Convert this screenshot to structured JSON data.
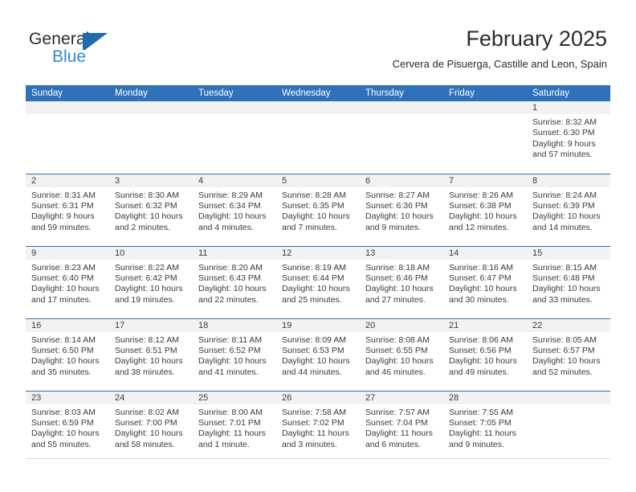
{
  "brand": {
    "name_part1": "General",
    "name_part2": "Blue",
    "flag_icon": "flag-triangle-icon"
  },
  "header": {
    "title": "February 2025",
    "subtitle": "Cervera de Pisuerga, Castille and Leon, Spain"
  },
  "theme": {
    "header_blue": "#3071b9",
    "daynum_band": "#f2f2f2",
    "brand_blue": "#2e8bd8",
    "text": "#3a3a3a"
  },
  "calendar": {
    "weekday_headers": [
      "Sunday",
      "Monday",
      "Tuesday",
      "Wednesday",
      "Thursday",
      "Friday",
      "Saturday"
    ],
    "weeks": [
      [
        {
          "empty": true
        },
        {
          "empty": true
        },
        {
          "empty": true
        },
        {
          "empty": true
        },
        {
          "empty": true
        },
        {
          "empty": true
        },
        {
          "day": "1",
          "sunrise": "Sunrise: 8:32 AM",
          "sunset": "Sunset: 6:30 PM",
          "daylight_line1": "Daylight: 9 hours",
          "daylight_line2": "and 57 minutes."
        }
      ],
      [
        {
          "day": "2",
          "sunrise": "Sunrise: 8:31 AM",
          "sunset": "Sunset: 6:31 PM",
          "daylight_line1": "Daylight: 9 hours",
          "daylight_line2": "and 59 minutes."
        },
        {
          "day": "3",
          "sunrise": "Sunrise: 8:30 AM",
          "sunset": "Sunset: 6:32 PM",
          "daylight_line1": "Daylight: 10 hours",
          "daylight_line2": "and 2 minutes."
        },
        {
          "day": "4",
          "sunrise": "Sunrise: 8:29 AM",
          "sunset": "Sunset: 6:34 PM",
          "daylight_line1": "Daylight: 10 hours",
          "daylight_line2": "and 4 minutes."
        },
        {
          "day": "5",
          "sunrise": "Sunrise: 8:28 AM",
          "sunset": "Sunset: 6:35 PM",
          "daylight_line1": "Daylight: 10 hours",
          "daylight_line2": "and 7 minutes."
        },
        {
          "day": "6",
          "sunrise": "Sunrise: 8:27 AM",
          "sunset": "Sunset: 6:36 PM",
          "daylight_line1": "Daylight: 10 hours",
          "daylight_line2": "and 9 minutes."
        },
        {
          "day": "7",
          "sunrise": "Sunrise: 8:26 AM",
          "sunset": "Sunset: 6:38 PM",
          "daylight_line1": "Daylight: 10 hours",
          "daylight_line2": "and 12 minutes."
        },
        {
          "day": "8",
          "sunrise": "Sunrise: 8:24 AM",
          "sunset": "Sunset: 6:39 PM",
          "daylight_line1": "Daylight: 10 hours",
          "daylight_line2": "and 14 minutes."
        }
      ],
      [
        {
          "day": "9",
          "sunrise": "Sunrise: 8:23 AM",
          "sunset": "Sunset: 6:40 PM",
          "daylight_line1": "Daylight: 10 hours",
          "daylight_line2": "and 17 minutes."
        },
        {
          "day": "10",
          "sunrise": "Sunrise: 8:22 AM",
          "sunset": "Sunset: 6:42 PM",
          "daylight_line1": "Daylight: 10 hours",
          "daylight_line2": "and 19 minutes."
        },
        {
          "day": "11",
          "sunrise": "Sunrise: 8:20 AM",
          "sunset": "Sunset: 6:43 PM",
          "daylight_line1": "Daylight: 10 hours",
          "daylight_line2": "and 22 minutes."
        },
        {
          "day": "12",
          "sunrise": "Sunrise: 8:19 AM",
          "sunset": "Sunset: 6:44 PM",
          "daylight_line1": "Daylight: 10 hours",
          "daylight_line2": "and 25 minutes."
        },
        {
          "day": "13",
          "sunrise": "Sunrise: 8:18 AM",
          "sunset": "Sunset: 6:46 PM",
          "daylight_line1": "Daylight: 10 hours",
          "daylight_line2": "and 27 minutes."
        },
        {
          "day": "14",
          "sunrise": "Sunrise: 8:16 AM",
          "sunset": "Sunset: 6:47 PM",
          "daylight_line1": "Daylight: 10 hours",
          "daylight_line2": "and 30 minutes."
        },
        {
          "day": "15",
          "sunrise": "Sunrise: 8:15 AM",
          "sunset": "Sunset: 6:48 PM",
          "daylight_line1": "Daylight: 10 hours",
          "daylight_line2": "and 33 minutes."
        }
      ],
      [
        {
          "day": "16",
          "sunrise": "Sunrise: 8:14 AM",
          "sunset": "Sunset: 6:50 PM",
          "daylight_line1": "Daylight: 10 hours",
          "daylight_line2": "and 35 minutes."
        },
        {
          "day": "17",
          "sunrise": "Sunrise: 8:12 AM",
          "sunset": "Sunset: 6:51 PM",
          "daylight_line1": "Daylight: 10 hours",
          "daylight_line2": "and 38 minutes."
        },
        {
          "day": "18",
          "sunrise": "Sunrise: 8:11 AM",
          "sunset": "Sunset: 6:52 PM",
          "daylight_line1": "Daylight: 10 hours",
          "daylight_line2": "and 41 minutes."
        },
        {
          "day": "19",
          "sunrise": "Sunrise: 8:09 AM",
          "sunset": "Sunset: 6:53 PM",
          "daylight_line1": "Daylight: 10 hours",
          "daylight_line2": "and 44 minutes."
        },
        {
          "day": "20",
          "sunrise": "Sunrise: 8:08 AM",
          "sunset": "Sunset: 6:55 PM",
          "daylight_line1": "Daylight: 10 hours",
          "daylight_line2": "and 46 minutes."
        },
        {
          "day": "21",
          "sunrise": "Sunrise: 8:06 AM",
          "sunset": "Sunset: 6:56 PM",
          "daylight_line1": "Daylight: 10 hours",
          "daylight_line2": "and 49 minutes."
        },
        {
          "day": "22",
          "sunrise": "Sunrise: 8:05 AM",
          "sunset": "Sunset: 6:57 PM",
          "daylight_line1": "Daylight: 10 hours",
          "daylight_line2": "and 52 minutes."
        }
      ],
      [
        {
          "day": "23",
          "sunrise": "Sunrise: 8:03 AM",
          "sunset": "Sunset: 6:59 PM",
          "daylight_line1": "Daylight: 10 hours",
          "daylight_line2": "and 55 minutes."
        },
        {
          "day": "24",
          "sunrise": "Sunrise: 8:02 AM",
          "sunset": "Sunset: 7:00 PM",
          "daylight_line1": "Daylight: 10 hours",
          "daylight_line2": "and 58 minutes."
        },
        {
          "day": "25",
          "sunrise": "Sunrise: 8:00 AM",
          "sunset": "Sunset: 7:01 PM",
          "daylight_line1": "Daylight: 11 hours",
          "daylight_line2": "and 1 minute."
        },
        {
          "day": "26",
          "sunrise": "Sunrise: 7:58 AM",
          "sunset": "Sunset: 7:02 PM",
          "daylight_line1": "Daylight: 11 hours",
          "daylight_line2": "and 3 minutes."
        },
        {
          "day": "27",
          "sunrise": "Sunrise: 7:57 AM",
          "sunset": "Sunset: 7:04 PM",
          "daylight_line1": "Daylight: 11 hours",
          "daylight_line2": "and 6 minutes."
        },
        {
          "day": "28",
          "sunrise": "Sunrise: 7:55 AM",
          "sunset": "Sunset: 7:05 PM",
          "daylight_line1": "Daylight: 11 hours",
          "daylight_line2": "and 9 minutes."
        },
        {
          "empty": true
        }
      ]
    ]
  }
}
